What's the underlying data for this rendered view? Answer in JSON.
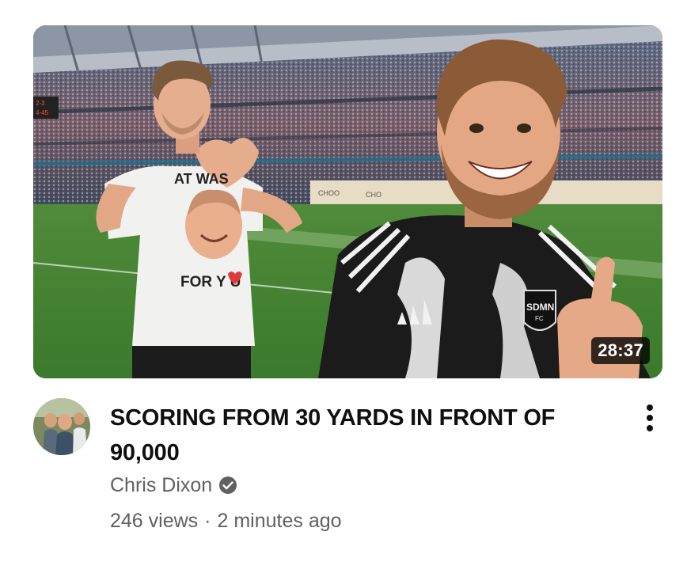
{
  "video": {
    "duration": "28:37",
    "title": "SCORING FROM 30 YARDS IN FRONT OF 90,000",
    "channel": "Chris Dixon",
    "views": "246 views",
    "separator": "·",
    "age": "2 minutes ago"
  },
  "thumbnail": {
    "shirt_text_top": "AT WAS",
    "shirt_text_bottom": "FOR Y U",
    "jersey_badge": "SDMN",
    "jersey_badge_sub": "FC",
    "scoreboard_line1": "2-3",
    "scoreboard_line2": "4-45"
  },
  "icons": {
    "verified": "verified-check-icon",
    "menu": "more-vert-icon"
  },
  "colors": {
    "title": "#0f0f0f",
    "secondary_text": "#606060",
    "duration_bg": "#000000"
  }
}
